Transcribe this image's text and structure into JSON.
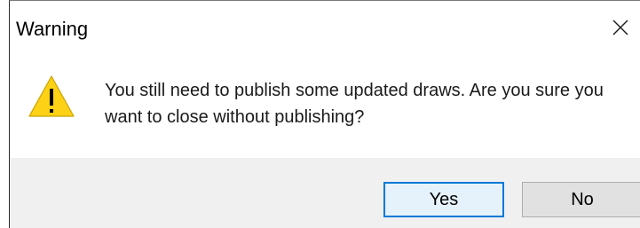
{
  "dialog": {
    "title": "Warning",
    "message": "You still need to publish some updated draws. Are you sure you want to close without publishing?",
    "icons": {
      "warning": "warning-icon",
      "close": "close-icon"
    },
    "buttons": {
      "yes_label": "Yes",
      "no_label": "No"
    },
    "colors": {
      "warning_fill": "#fcd116",
      "default_button_border": "#0078d7",
      "footer_background": "#f0f0f0"
    }
  }
}
